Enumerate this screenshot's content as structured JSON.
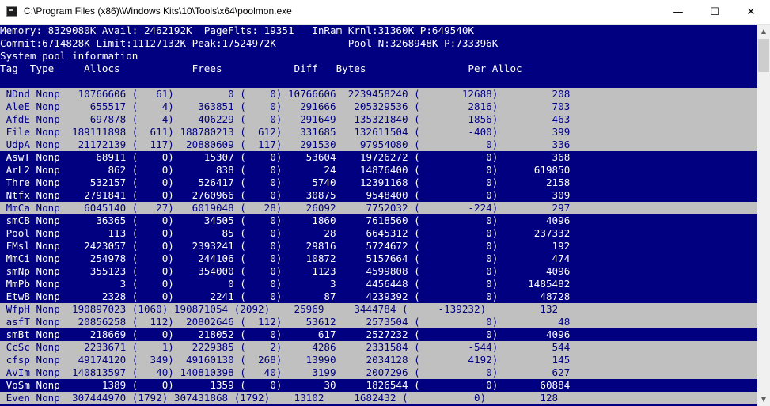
{
  "window": {
    "title": "C:\\Program Files (x86)\\Windows Kits\\10\\Tools\\x64\\poolmon.exe",
    "minimize_glyph": "—",
    "maximize_glyph": "☐",
    "close_glyph": "✕"
  },
  "colors": {
    "console_bg": "#000080",
    "console_fg": "#ffffff",
    "highlight_bg": "#c0c0c0",
    "highlight_fg": "#000080"
  },
  "scrollbar": {
    "up_glyph": "▲",
    "down_glyph": "▼"
  },
  "header_lines": [
    "Memory: 8329080K Avail: 2462192K  PageFlts: 19351   InRam Krnl:31360K P:649540K",
    "Commit:6714828K Limit:11127132K Peak:17524972K            Pool N:3268948K P:733396K",
    "System pool information",
    "Tag  Type     Allocs            Frees            Diff   Bytes                 Per Alloc"
  ],
  "rows": [
    {
      "text": " NDnd Nonp   10766606 (   61)         0 (    0) 10766606  2239458240 (       12688)         208",
      "highlight": true
    },
    {
      "text": " AleE Nonp     655517 (    4)    363851 (    0)   291666   205329536 (        2816)         703",
      "highlight": true
    },
    {
      "text": " AfdE Nonp     697878 (    4)    406229 (    0)   291649   135321840 (        1856)         463",
      "highlight": true
    },
    {
      "text": " File Nonp  189111898 (  611) 188780213 (  612)   331685   132611504 (        -400)         399",
      "highlight": true
    },
    {
      "text": " UdpA Nonp   21172139 (  117)  20880609 (  117)   291530    97954080 (           0)         336",
      "highlight": true
    },
    {
      "text": " AswT Nonp      68911 (    0)     15307 (    0)    53604    19726272 (           0)         368",
      "highlight": false
    },
    {
      "text": " ArL2 Nonp        862 (    0)       838 (    0)       24    14876400 (           0)      619850",
      "highlight": false
    },
    {
      "text": " Thre Nonp     532157 (    0)    526417 (    0)     5740    12391168 (           0)        2158",
      "highlight": false
    },
    {
      "text": " Ntfx Nonp    2791841 (    0)   2760966 (    0)    30875     9548400 (           0)         309",
      "highlight": false
    },
    {
      "text": " MmCa Nonp    6045140 (   27)   6019048 (   28)    26092     7752032 (        -224)         297",
      "highlight": true
    },
    {
      "text": " smCB Nonp      36365 (    0)     34505 (    0)     1860     7618560 (           0)        4096",
      "highlight": false
    },
    {
      "text": " Pool Nonp        113 (    0)        85 (    0)       28     6645312 (           0)      237332",
      "highlight": false
    },
    {
      "text": " FMsl Nonp    2423057 (    0)   2393241 (    0)    29816     5724672 (           0)         192",
      "highlight": false
    },
    {
      "text": " MmCi Nonp     254978 (    0)    244106 (    0)    10872     5157664 (           0)         474",
      "highlight": false
    },
    {
      "text": " smNp Nonp     355123 (    0)    354000 (    0)     1123     4599808 (           0)        4096",
      "highlight": false
    },
    {
      "text": " MmPb Nonp          3 (    0)         0 (    0)        3     4456448 (           0)     1485482",
      "highlight": false
    },
    {
      "text": " EtwB Nonp       2328 (    0)      2241 (    0)       87     4239392 (           0)       48728",
      "highlight": false
    },
    {
      "text": " WfpH Nonp  190897023 (1060) 190871054 (2092)    25969     3444784 (     -139232)         132",
      "highlight": true
    },
    {
      "text": " asfT Nonp   20856258 (  112)  20802646 (  112)    53612     2573504 (           0)          48",
      "highlight": true
    },
    {
      "text": " smBt Nonp     218669 (    0)    218052 (    0)      617     2527232 (           0)        4096",
      "highlight": false
    },
    {
      "text": " CcSc Nonp    2233671 (    1)   2229385 (    2)     4286     2331584 (        -544)         544",
      "highlight": true
    },
    {
      "text": " cfsp Nonp   49174120 (  349)  49160130 (  268)    13990     2034128 (        4192)         145",
      "highlight": true
    },
    {
      "text": " AvIm Nonp  140813597 (   40) 140810398 (   40)     3199     2007296 (           0)         627",
      "highlight": true
    },
    {
      "text": " VoSm Nonp       1389 (    0)      1359 (    0)       30     1826544 (           0)       60884",
      "highlight": false
    },
    {
      "text": " Even Nonp  307444970 (1792) 307431868 (1792)    13102     1682432 (           0)         128",
      "highlight": true
    }
  ]
}
